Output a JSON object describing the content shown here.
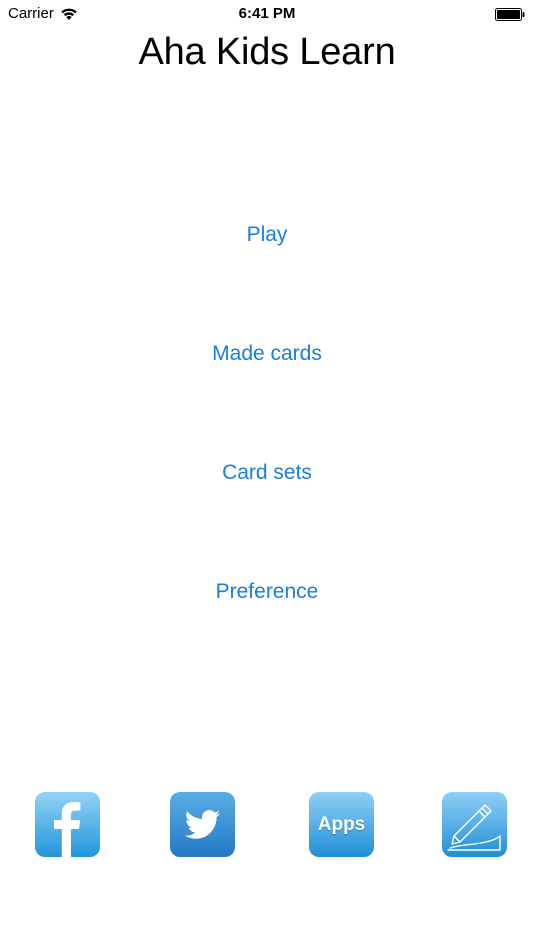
{
  "status_bar": {
    "carrier": "Carrier",
    "time": "6:41 PM",
    "icons": [
      "wifi-icon",
      "battery-icon"
    ]
  },
  "app": {
    "title": "Aha Kids Learn"
  },
  "menu": {
    "play": "Play",
    "made_cards": "Made cards",
    "card_sets": "Card sets",
    "preference": "Preference"
  },
  "share_bar": {
    "facebook_icon": "facebook-icon",
    "twitter_icon": "twitter-icon",
    "apps_label": "Apps",
    "edit_icon": "pencil-edit-icon"
  },
  "colors": {
    "link": "#1a7ee0",
    "tile_light": "#8fd0f6",
    "tile_dark": "#1f8fd6"
  }
}
